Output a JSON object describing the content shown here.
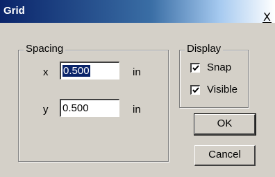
{
  "window": {
    "title": "Grid",
    "close_glyph": "X"
  },
  "spacing": {
    "legend": "Spacing",
    "x_label": "x",
    "x_value": "0.500",
    "x_unit": "in",
    "y_label": "y",
    "y_value": "0.500",
    "y_unit": "in"
  },
  "display": {
    "legend": "Display",
    "snap_label": "Snap",
    "snap_checked": true,
    "visible_label": "Visible",
    "visible_checked": true
  },
  "buttons": {
    "ok": "OK",
    "cancel": "Cancel"
  },
  "colors": {
    "title_bar_start": "#0a246a",
    "face": "#d4d0c8",
    "selection": "#0a246a"
  }
}
